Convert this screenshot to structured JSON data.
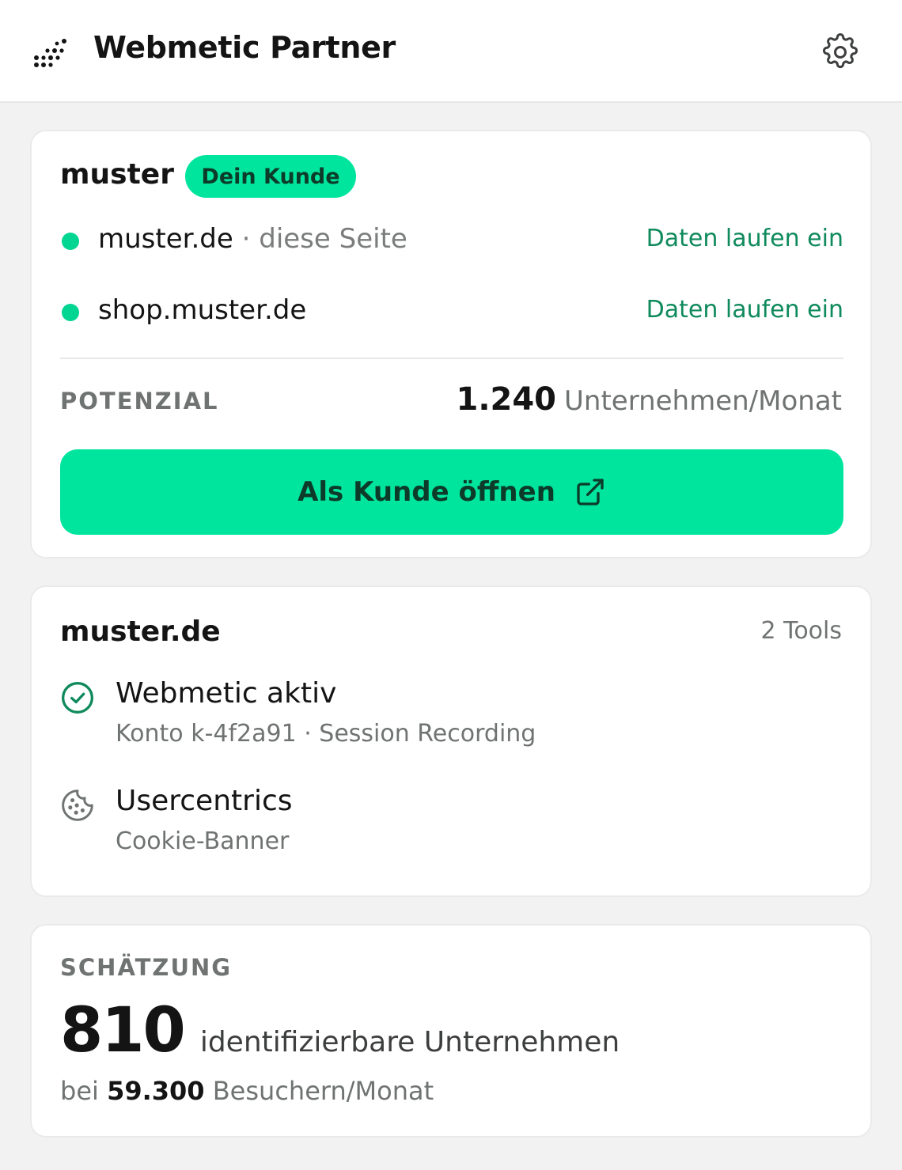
{
  "header": {
    "title": "Webmetic Partner",
    "logo_icon": "dotted-logo-icon",
    "settings_icon": "gear-icon"
  },
  "client_card": {
    "name": "muster",
    "badge": "Dein Kunde",
    "sites": [
      {
        "domain": "muster.de",
        "separator": "·",
        "note": "diese Seite",
        "status": "Daten laufen ein"
      },
      {
        "domain": "shop.muster.de",
        "status": "Daten laufen ein"
      }
    ],
    "potential": {
      "label": "POTENZIAL",
      "value": "1.240",
      "unit": "Unternehmen/Monat"
    },
    "cta": {
      "label": "Als Kunde öffnen",
      "icon": "external-link-icon"
    }
  },
  "tools_card": {
    "domain": "muster.de",
    "count": "2 Tools",
    "tools": [
      {
        "icon": "check-circle-icon",
        "name": "Webmetic aktiv",
        "detail": "Konto k-4f2a91 · Session Recording"
      },
      {
        "icon": "cookie-icon",
        "name": "Usercentrics",
        "detail": "Cookie-Banner"
      }
    ]
  },
  "estimate_card": {
    "label": "SCHÄTZUNG",
    "value": "810",
    "unit": "identifizierbare Unternehmen",
    "sub_prefix": "bei",
    "sub_value": "59.300",
    "sub_unit": "Besuchern/Monat"
  },
  "colors": {
    "accent": "#00e59e",
    "status_green": "#0f8a5c",
    "dot_green": "#00d692",
    "background": "#f1f2f1"
  }
}
